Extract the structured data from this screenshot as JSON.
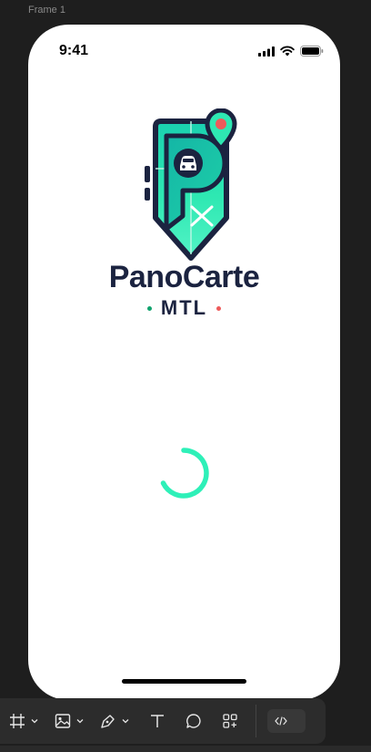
{
  "canvas": {
    "frame_label": "Frame 1"
  },
  "status_bar": {
    "time": "9:41"
  },
  "brand": {
    "name": "PanoCarte",
    "tagline": "MTL",
    "colors": {
      "navy": "#1b2340",
      "teal": "#19c9a2",
      "mint": "#2ef0b8",
      "red": "#ee5a5a",
      "green_dot": "#11a36e"
    }
  },
  "loading": {
    "spinner_color": "#2ef0b8"
  },
  "toolbar": {
    "tools": [
      {
        "name": "frame-tool",
        "icon": "hash-frame-icon",
        "has_menu": true
      },
      {
        "name": "image-tool",
        "icon": "image-icon",
        "has_menu": true
      },
      {
        "name": "pen-tool",
        "icon": "pen-icon",
        "has_menu": true
      },
      {
        "name": "text-tool",
        "icon": "text-icon",
        "has_menu": false
      },
      {
        "name": "comment-tool",
        "icon": "comment-icon",
        "has_menu": false
      },
      {
        "name": "components-tool",
        "icon": "components-icon",
        "has_menu": false
      }
    ],
    "dev_mode_icon": "code-icon"
  }
}
